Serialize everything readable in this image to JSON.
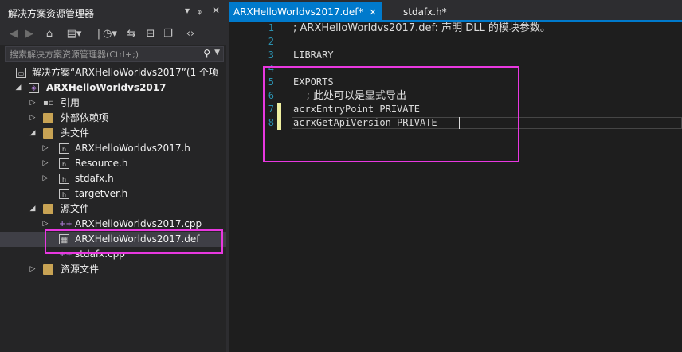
{
  "solution_explorer": {
    "title": "解决方案资源管理器",
    "title_buttons": [
      "▾",
      "ᵩ",
      "✕"
    ],
    "search_placeholder": "搜索解决方案资源管理器(Ctrl+;)",
    "tree": [
      {
        "label": "解决方案“ARXHelloWorldvs2017”(1 个项",
        "icon": "solution-icon",
        "expander": ""
      },
      {
        "label": "ARXHelloWorldvs2017",
        "icon": "project-icon",
        "expander": "◢",
        "bold": true
      },
      {
        "label": "引用",
        "icon": "references-icon",
        "expander": "▷"
      },
      {
        "label": "外部依赖项",
        "icon": "folder-icon",
        "expander": "▷"
      },
      {
        "label": "头文件",
        "icon": "folder-icon",
        "expander": "◢"
      },
      {
        "label": "ARXHelloWorldvs2017.h",
        "icon": "header-file-icon",
        "expander": "▷"
      },
      {
        "label": "Resource.h",
        "icon": "header-file-icon",
        "expander": "▷"
      },
      {
        "label": "stdafx.h",
        "icon": "header-file-icon",
        "expander": "▷"
      },
      {
        "label": "targetver.h",
        "icon": "header-file-icon",
        "expander": ""
      },
      {
        "label": "源文件",
        "icon": "folder-icon",
        "expander": "◢"
      },
      {
        "label": "ARXHelloWorldvs2017.cpp",
        "icon": "cpp-file-icon",
        "expander": "▷"
      },
      {
        "label": "ARXHelloWorldvs2017.def",
        "icon": "def-file-icon",
        "expander": "",
        "selected": true
      },
      {
        "label": "stdafx.cpp",
        "icon": "cpp-file-icon",
        "expander": ""
      },
      {
        "label": "资源文件",
        "icon": "folder-icon",
        "expander": "▷"
      }
    ]
  },
  "editor": {
    "tabs": [
      {
        "label": "ARXHelloWorldvs2017.def*",
        "active": true,
        "close": "✕"
      },
      {
        "label": "stdafx.h*",
        "active": false
      }
    ],
    "lines": [
      {
        "num": "1",
        "text": "; ARXHelloWorldvs2017.def: 声明 DLL 的模块参数。"
      },
      {
        "num": "2",
        "text": ""
      },
      {
        "num": "3",
        "text": "LIBRARY"
      },
      {
        "num": "4",
        "text": ""
      },
      {
        "num": "5",
        "text": "EXPORTS"
      },
      {
        "num": "6",
        "text": "    ; 此处可以是显式导出"
      },
      {
        "num": "7",
        "text": "acrxEntryPoint PRIVATE",
        "changed": true
      },
      {
        "num": "8",
        "text": "acrxGetApiVersion PRIVATE ",
        "changed": true,
        "current": true
      }
    ]
  },
  "colors": {
    "accent": "#007acc",
    "annotation": "#e838e0",
    "line_number": "#2b91af",
    "changed_marker": "#efefa0"
  }
}
